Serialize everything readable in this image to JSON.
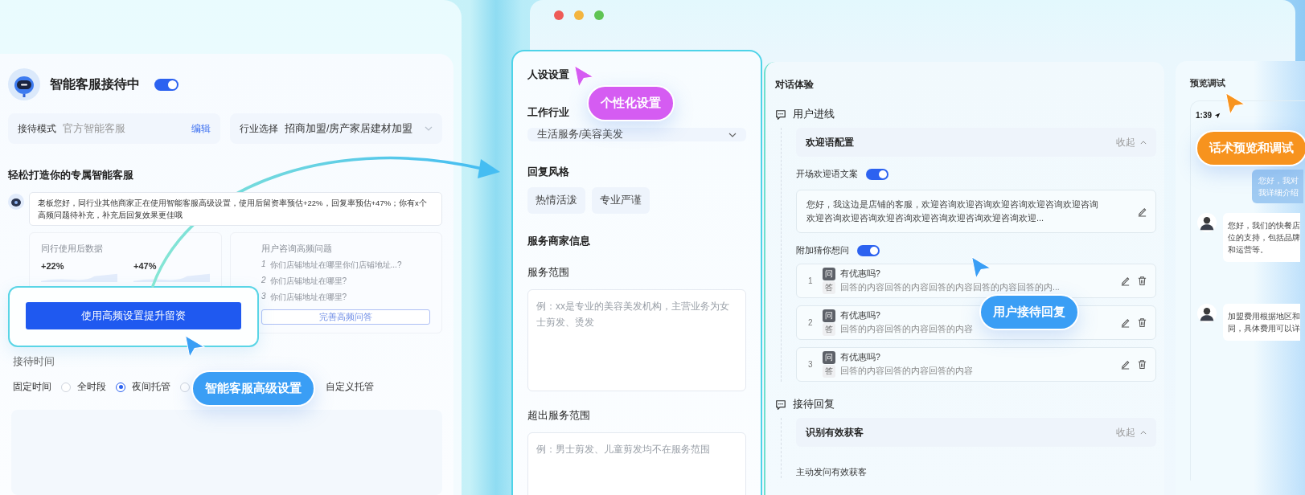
{
  "left_panel": {
    "status": {
      "title": "智能客服接待中",
      "on": true
    },
    "mode": {
      "label": "接待模式",
      "value": "官方智能客服",
      "action": "编辑"
    },
    "industry": {
      "label": "行业选择",
      "value": "招商加盟/房产家居建材加盟"
    },
    "heading": "轻松打造你的专属智能客服",
    "message": "老板您好，同行业其他商家正在使用智能客服高级设置，使用后留资率预估+22%，回复率预估+47%；你有x个高频问题待补充，补充后回复效果更佳哦",
    "stats": {
      "title": "同行使用后数据",
      "items": [
        {
          "value": "+22%"
        },
        {
          "value": "+47%"
        }
      ]
    },
    "faq": {
      "title": "用户咨询高频问题",
      "items": [
        {
          "index": "1",
          "text": "你们店铺地址在哪里你们店铺地址...?"
        },
        {
          "index": "2",
          "text": "你们店铺地址在哪里?"
        },
        {
          "index": "3",
          "text": "你们店铺地址在哪里?"
        }
      ],
      "button": "完善高频问答"
    },
    "cta_button": "使用高频设置提升留资",
    "reception_time": {
      "title": "接待时间",
      "label": "固定时间",
      "options": [
        {
          "label": "全时段",
          "selected": false
        },
        {
          "label": "夜间托管",
          "selected": true
        },
        {
          "selected": false
        },
        {
          "label": "自定义托管"
        }
      ]
    }
  },
  "persona_panel": {
    "title": "人设设置",
    "industry": {
      "label": "工作行业",
      "value": "生活服务/美容美发"
    },
    "style": {
      "label": "回复风格",
      "options": [
        "热情活泼",
        "专业严谨"
      ]
    },
    "merchant": {
      "title": "服务商家信息",
      "fields": [
        {
          "label": "服务范围",
          "placeholder": "例：xx是专业的美容美发机构，主营业务为女士剪发、烫发"
        },
        {
          "label": "超出服务范围",
          "placeholder": "例：男士剪发、儿童剪发均不在服务范围"
        }
      ]
    }
  },
  "dialog_panel": {
    "title": "对话体验",
    "sections": [
      {
        "title": "用户进线",
        "group": {
          "title": "欢迎语配置",
          "collapse": "收起"
        },
        "welcome": {
          "label": "开场欢迎语文案",
          "on": true,
          "text": "您好，我这边是店铺的客服，欢迎咨询欢迎咨询欢迎咨询欢迎咨询欢迎咨询欢迎咨询欢迎咨询欢迎咨询欢迎咨询欢迎咨询欢迎咨询欢迎..."
        },
        "guess": {
          "label": "附加猜你想问",
          "on": true,
          "items": [
            {
              "index": "1",
              "q_tag": "问",
              "question": "有优惠吗?",
              "a_tag": "答",
              "answer": "回答的内容回答的内容回答的内容回答的内容回答的内..."
            },
            {
              "index": "2",
              "q_tag": "问",
              "question": "有优惠吗?",
              "a_tag": "答",
              "answer": "回答的内容回答的内容回答的内容"
            },
            {
              "index": "3",
              "q_tag": "问",
              "question": "有优惠吗?",
              "a_tag": "答",
              "answer": "回答的内容回答的内容回答的内容"
            }
          ]
        }
      },
      {
        "title": "接待回复",
        "group": {
          "title": "识别有效获客",
          "collapse": "收起"
        },
        "sub": "主动发问有效获客"
      }
    ]
  },
  "preview_panel": {
    "title": "预览调试",
    "phone_time": "1:39",
    "messages": [
      {
        "kind": "user",
        "lines": [
          "您好，我对",
          "我详细介绍"
        ]
      },
      {
        "kind": "bot",
        "lines": [
          "您好，我们的快餐店",
          "位的支持，包括品牌",
          "和运营等。"
        ]
      },
      {
        "kind": "bot",
        "lines": [
          "加盟费用根据地区和",
          "同，具体费用可以详"
        ]
      }
    ]
  },
  "callouts": [
    {
      "text": "智能客服高级设置",
      "color": "#3a9ef5"
    },
    {
      "text": "个性化设置",
      "color": "#d55cf2"
    },
    {
      "text": "用户接待回复",
      "color": "#3a9ef5"
    },
    {
      "text": "话术预览和调试",
      "color": "#f7931e"
    }
  ]
}
